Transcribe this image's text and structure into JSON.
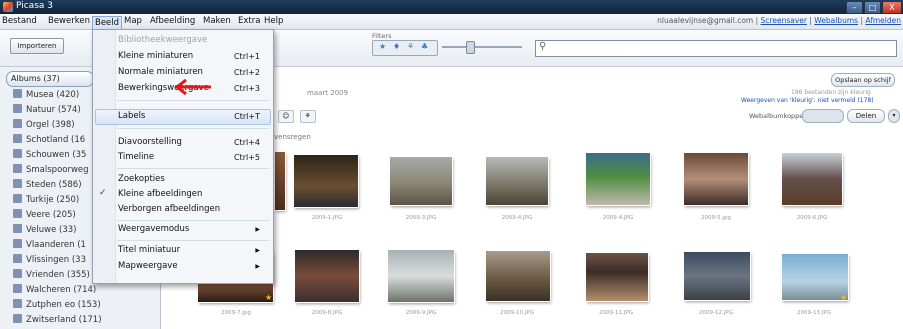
{
  "window": {
    "title": "Picasa 3",
    "controls": [
      "–",
      "□",
      "X"
    ]
  },
  "menubar": {
    "items": [
      "Bestand",
      "Bewerken",
      "Beeld",
      "Map",
      "Afbeelding",
      "Maken",
      "Extra",
      "Help"
    ],
    "account": "nluaalevijnse@gmail.com",
    "links": [
      "Screensaver",
      "Webalbums",
      "Afmelden"
    ],
    "link_sep": "|"
  },
  "toolbar": {
    "import_label": "Importeren",
    "filters_label": "Filters",
    "filter_icons": [
      "★",
      "♦",
      "⚘",
      "♣"
    ]
  },
  "sidebar": {
    "header": "Albums (37)",
    "items": [
      "Musea (420)",
      "Natuur (574)",
      "Orgel (398)",
      "Schotland (16",
      "Schouwen (35",
      "Smalspoorweg",
      "Steden (586)",
      "Turkije (250)",
      "Veere (205)",
      "Veluwe (33)",
      "Vlaanderen (1",
      "Vlissingen (33",
      "Vrienden (355)",
      "Walcheren (714)",
      "Zutphen eo (153)",
      "Zwitserland (171)"
    ]
  },
  "main": {
    "date_text": "maart 2009",
    "section_label": "vensregen",
    "upload_label": "Opslaan op schijf",
    "info_line1": "186 bestanden zijn kleurig",
    "info_line2": "Weergeven van 'kleurig': niet vermeld (178)",
    "share_label": "Webalbumkoppeling",
    "share_button": "Delen",
    "small_buttons": [
      "★",
      "☺",
      "⚘"
    ],
    "row1_captions": [
      "2009-1.JPG",
      "2009-3.JPG",
      "2009-4.JPG",
      "2009-4.JPG",
      "2009-5.jpg",
      "2009-6.JPG"
    ],
    "row2_captions": [
      "2009-7.jpg",
      "2009-8.JPG",
      "2009-9.JPG",
      "2009-10.JPG",
      "2009-11.JPG",
      "2009-12.JPG",
      "2009-13.JPG"
    ]
  },
  "dropdown": {
    "items": [
      {
        "label": "Bibliotheekweergave",
        "shortcut": "",
        "disabled": true
      },
      {
        "label": "Kleine miniaturen",
        "shortcut": "Ctrl+1"
      },
      {
        "label": "Normale miniaturen",
        "shortcut": "Ctrl+2"
      },
      {
        "label": "Bewerkingsweergave",
        "shortcut": "Ctrl+3"
      },
      {
        "label": "Labels",
        "shortcut": "Ctrl+T"
      },
      {
        "label": "Diavoorstelling",
        "shortcut": "Ctrl+4"
      },
      {
        "label": "Timeline",
        "shortcut": "Ctrl+5"
      },
      {
        "label": "Zoekopties",
        "shortcut": ""
      },
      {
        "label": "Kleine afbeeldingen",
        "shortcut": "",
        "checked": true
      },
      {
        "label": "Verborgen afbeeldingen",
        "shortcut": ""
      },
      {
        "label": "Weergavemodus",
        "shortcut": "",
        "submenu": true
      },
      {
        "label": "Titel miniatuur",
        "shortcut": "",
        "submenu": true
      },
      {
        "label": "Mapweergave",
        "shortcut": "",
        "submenu": true
      }
    ],
    "check_glyph": "✓",
    "submenu_glyph": "▶"
  }
}
